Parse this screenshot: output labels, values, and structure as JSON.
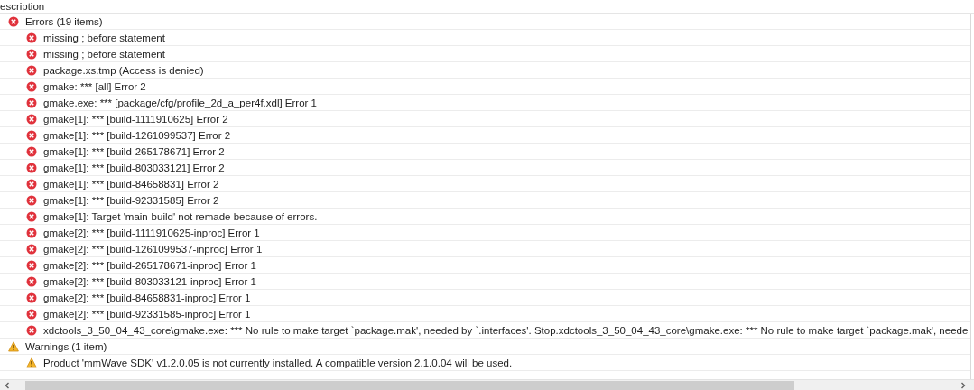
{
  "column_header": "escription",
  "groups": [
    {
      "kind": "error",
      "label": "Errors (19 items)",
      "children": [
        {
          "kind": "error",
          "label": "missing ; before statement"
        },
        {
          "kind": "error",
          "label": "missing ; before statement"
        },
        {
          "kind": "error",
          "label": "package.xs.tmp (Access is denied)"
        },
        {
          "kind": "error",
          "label": "gmake: *** [all] Error 2"
        },
        {
          "kind": "error",
          "label": "gmake.exe: *** [package/cfg/profile_2d_a_per4f.xdl] Error 1"
        },
        {
          "kind": "error",
          "label": "gmake[1]: *** [build-1111910625] Error 2"
        },
        {
          "kind": "error",
          "label": "gmake[1]: *** [build-1261099537] Error 2"
        },
        {
          "kind": "error",
          "label": "gmake[1]: *** [build-265178671] Error 2"
        },
        {
          "kind": "error",
          "label": "gmake[1]: *** [build-803033121] Error 2"
        },
        {
          "kind": "error",
          "label": "gmake[1]: *** [build-84658831] Error 2"
        },
        {
          "kind": "error",
          "label": "gmake[1]: *** [build-92331585] Error 2"
        },
        {
          "kind": "error",
          "label": "gmake[1]: Target 'main-build' not remade because of errors."
        },
        {
          "kind": "error",
          "label": "gmake[2]: *** [build-1111910625-inproc] Error 1"
        },
        {
          "kind": "error",
          "label": "gmake[2]: *** [build-1261099537-inproc] Error 1"
        },
        {
          "kind": "error",
          "label": "gmake[2]: *** [build-265178671-inproc] Error 1"
        },
        {
          "kind": "error",
          "label": "gmake[2]: *** [build-803033121-inproc] Error 1"
        },
        {
          "kind": "error",
          "label": "gmake[2]: *** [build-84658831-inproc] Error 1"
        },
        {
          "kind": "error",
          "label": "gmake[2]: *** [build-92331585-inproc] Error 1"
        },
        {
          "kind": "error",
          "label": "xdctools_3_50_04_43_core\\gmake.exe: *** No rule to make target `package.mak', needed by `.interfaces'.  Stop.xdctools_3_50_04_43_core\\gmake.exe: *** No rule to make target `package.mak', neede"
        }
      ]
    },
    {
      "kind": "warning",
      "label": "Warnings (1 item)",
      "children": [
        {
          "kind": "warning",
          "label": "Product 'mmWave SDK' v1.2.0.05 is not currently installed. A compatible version 2.1.0.04 will be used."
        }
      ]
    }
  ]
}
